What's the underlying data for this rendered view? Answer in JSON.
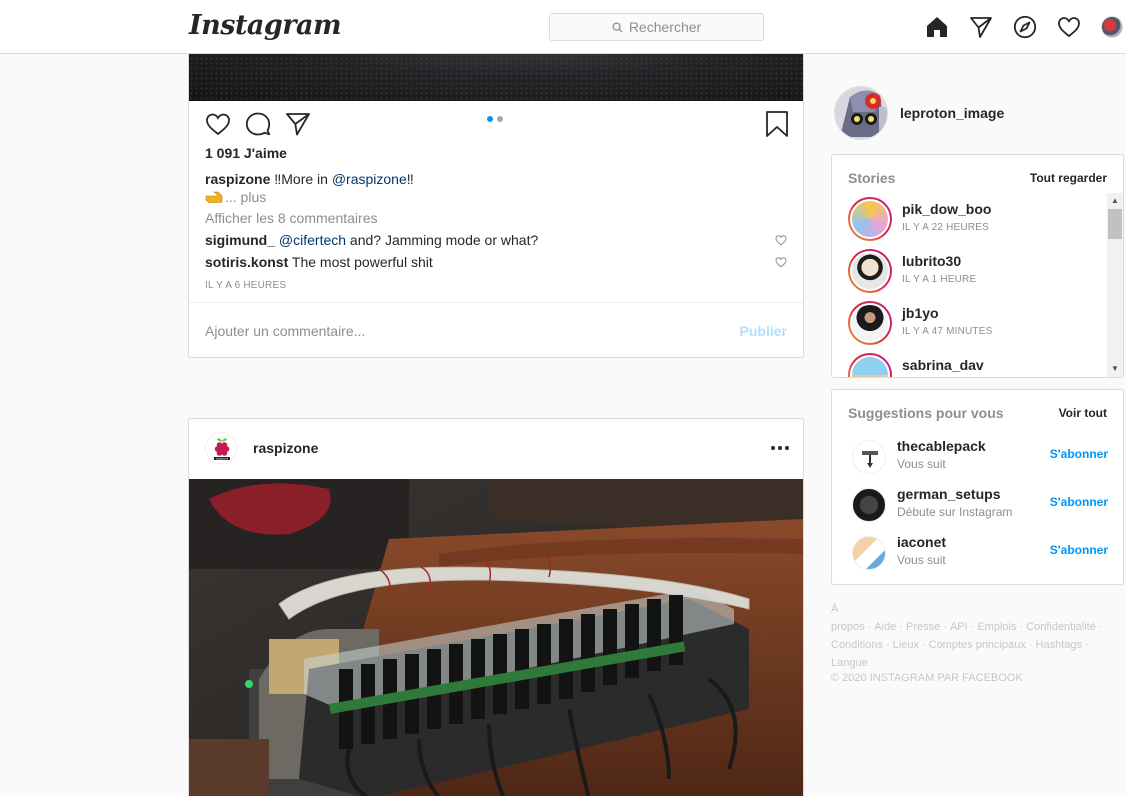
{
  "header": {
    "logo": "Instagram",
    "search_placeholder": "Rechercher",
    "icons": [
      "home-icon",
      "direct-icon",
      "explore-icon",
      "activity-heart-icon",
      "profile-avatar"
    ]
  },
  "post1": {
    "likes": "1 091 J'aime",
    "caption_user": "raspizone",
    "caption_text_1": " ‼More in ",
    "caption_mention": "@raspizone",
    "caption_text_2": "‼",
    "more_text": "... plus",
    "view_comments": "Afficher les 8 commentaires",
    "comments": [
      {
        "user": "sigimund_",
        "mention": "@cifertech",
        "text": " and? Jamming mode or what?"
      },
      {
        "user": "sotiris.konst",
        "mention": "",
        "text": "The most powerful shit"
      }
    ],
    "time": "IL Y A 6 HEURES",
    "comment_placeholder": "Ajouter un commentaire...",
    "publish_label": "Publier"
  },
  "post2": {
    "user": "raspizone",
    "avatar_text": "raspizone"
  },
  "sidebar": {
    "me": {
      "username": "leproton_image"
    },
    "stories": {
      "title": "Stories",
      "see_all": "Tout regarder",
      "items": [
        {
          "name": "pik_dow_boo",
          "time": "IL Y A 22 HEURES"
        },
        {
          "name": "lubrito30",
          "time": "IL Y A 1 HEURE"
        },
        {
          "name": "jb1yo",
          "time": "IL Y A 47 MINUTES"
        },
        {
          "name": "sabrina_dav",
          "time": ""
        }
      ]
    },
    "suggestions": {
      "title": "Suggestions pour vous",
      "see_all": "Voir tout",
      "items": [
        {
          "name": "thecablepack",
          "sub": "Vous suit",
          "action": "S'abonner"
        },
        {
          "name": "german_setups",
          "sub": "Débute sur Instagram",
          "action": "S'abonner"
        },
        {
          "name": "iaconet",
          "sub": "Vous suit",
          "action": "S'abonner"
        }
      ]
    },
    "footer": {
      "links": [
        "À propos",
        "Aide",
        "Presse",
        "API",
        "Emplois",
        "Confidentialité",
        "Conditions",
        "Lieux",
        "Comptes principaux",
        "Hashtags",
        "Langue"
      ],
      "copyright": "© 2020 INSTAGRAM PAR FACEBOOK"
    }
  },
  "colors": {
    "accent": "#0095f6",
    "text": "#262626",
    "muted": "#8e8e8e",
    "border": "#dbdbdb",
    "background": "#fafafa"
  }
}
